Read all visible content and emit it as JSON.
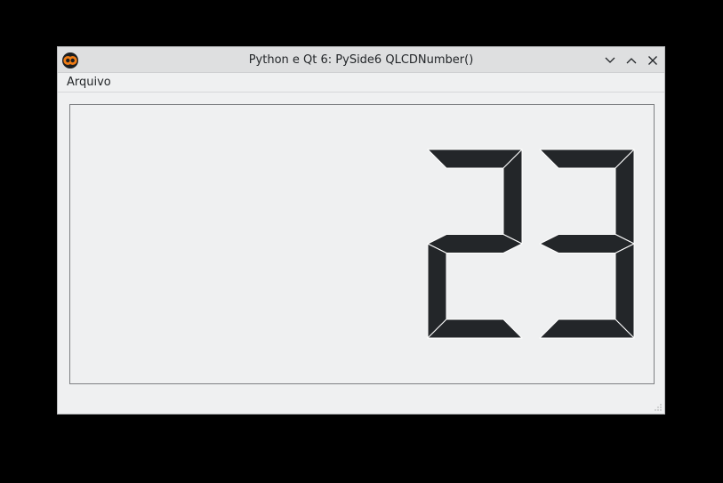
{
  "window": {
    "title": "Python e Qt 6: PySide6 QLCDNumber()"
  },
  "titlebar": {
    "icon": "app-logo-icon",
    "buttons": [
      "minimize-icon",
      "maximize-icon",
      "close-icon"
    ]
  },
  "menubar": {
    "items": [
      {
        "label": "Arquivo"
      }
    ]
  },
  "lcd": {
    "value": "23",
    "digits": 2,
    "segment_color": "#232629",
    "highlight_color": "#ffffff"
  },
  "colors": {
    "background": "#eff0f1",
    "titlebar": "#dedfe0",
    "text": "#232629",
    "logo_orange": "#f07c15"
  }
}
